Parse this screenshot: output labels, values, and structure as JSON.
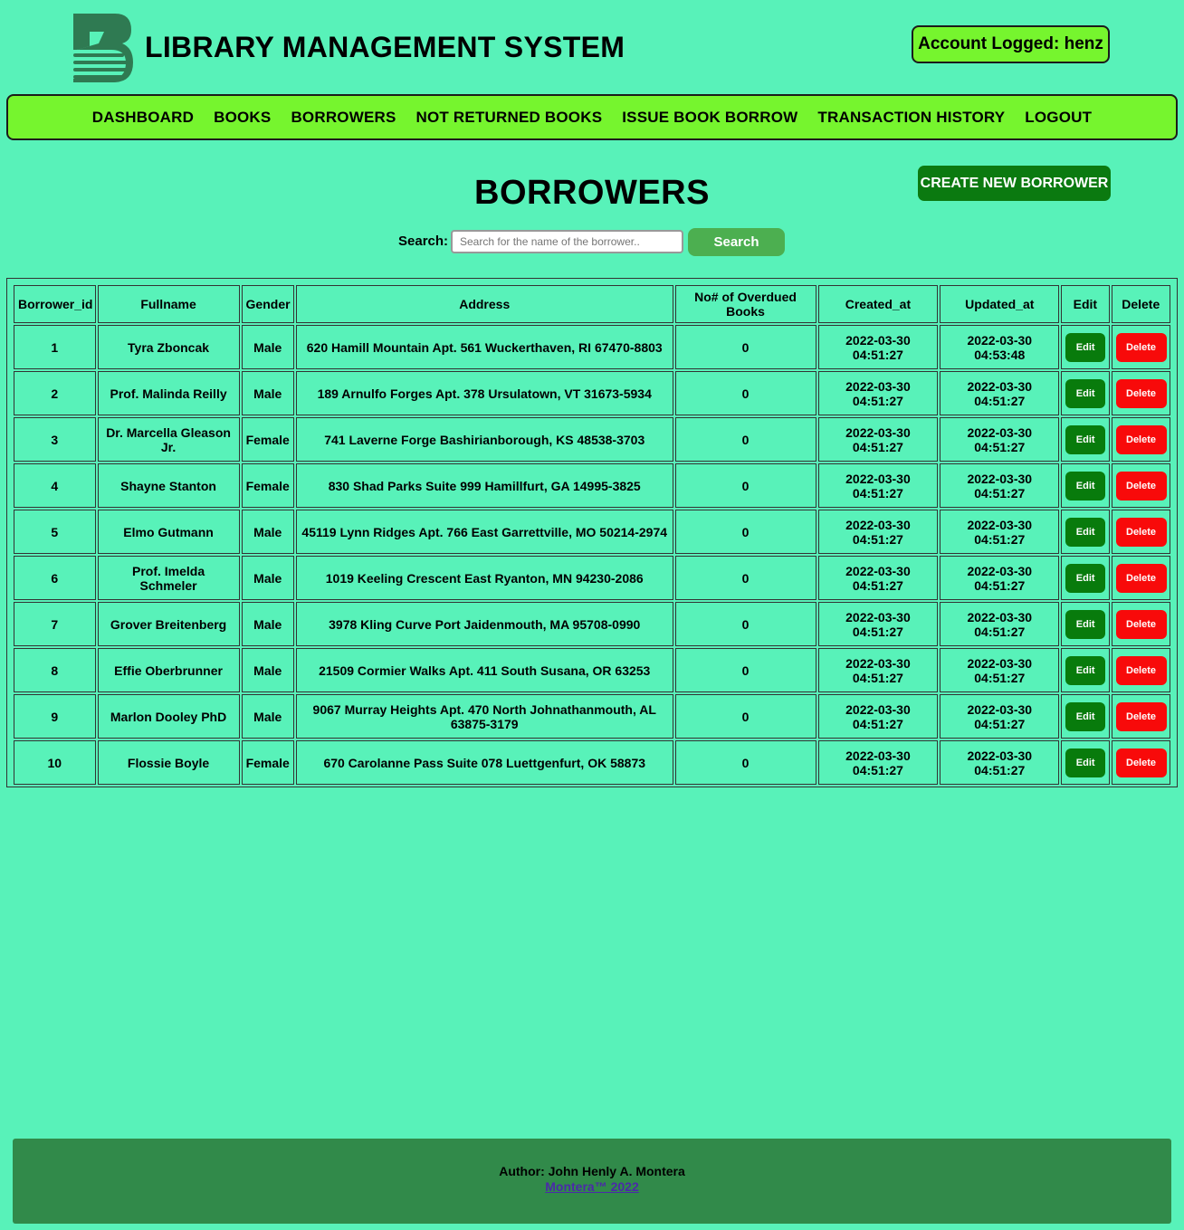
{
  "header": {
    "app_title": "LIBRARY MANAGEMENT SYSTEM",
    "account_label": "Account Logged: henz"
  },
  "nav": {
    "items": [
      "DASHBOARD",
      "BOOKS",
      "BORROWERS",
      "NOT RETURNED BOOKS",
      "ISSUE BOOK BORROW",
      "TRANSACTION HISTORY",
      "LOGOUT"
    ]
  },
  "main": {
    "title": "BORROWERS",
    "create_button": "CREATE NEW BORROWER",
    "search": {
      "label": "Search:",
      "placeholder": "Search for the name of the borrower..",
      "button": "Search"
    }
  },
  "table": {
    "columns": [
      "Borrower_id",
      "Fullname",
      "Gender",
      "Address",
      "No# of Overdued Books",
      "Created_at",
      "Updated_at",
      "Edit",
      "Delete"
    ],
    "edit_label": "Edit",
    "delete_label": "Delete",
    "rows": [
      {
        "id": "1",
        "fullname": "Tyra Zboncak",
        "gender": "Male",
        "address": "620 Hamill Mountain Apt. 561 Wuckerthaven, RI 67470-8803",
        "overdue": "0",
        "created_date": "2022-03-30",
        "created_time": "04:51:27",
        "updated_date": "2022-03-30",
        "updated_time": "04:53:48"
      },
      {
        "id": "2",
        "fullname": "Prof. Malinda Reilly",
        "gender": "Male",
        "address": "189 Arnulfo Forges Apt. 378 Ursulatown, VT 31673-5934",
        "overdue": "0",
        "created_date": "2022-03-30",
        "created_time": "04:51:27",
        "updated_date": "2022-03-30",
        "updated_time": "04:51:27"
      },
      {
        "id": "3",
        "fullname": "Dr. Marcella Gleason Jr.",
        "gender": "Female",
        "address": "741 Laverne Forge Bashirianborough, KS 48538-3703",
        "overdue": "0",
        "created_date": "2022-03-30",
        "created_time": "04:51:27",
        "updated_date": "2022-03-30",
        "updated_time": "04:51:27"
      },
      {
        "id": "4",
        "fullname": "Shayne Stanton",
        "gender": "Female",
        "address": "830 Shad Parks Suite 999 Hamillfurt, GA 14995-3825",
        "overdue": "0",
        "created_date": "2022-03-30",
        "created_time": "04:51:27",
        "updated_date": "2022-03-30",
        "updated_time": "04:51:27"
      },
      {
        "id": "5",
        "fullname": "Elmo Gutmann",
        "gender": "Male",
        "address": "45119 Lynn Ridges Apt. 766 East Garrettville, MO 50214-2974",
        "overdue": "0",
        "created_date": "2022-03-30",
        "created_time": "04:51:27",
        "updated_date": "2022-03-30",
        "updated_time": "04:51:27"
      },
      {
        "id": "6",
        "fullname": "Prof. Imelda Schmeler",
        "gender": "Male",
        "address": "1019 Keeling Crescent East Ryanton, MN 94230-2086",
        "overdue": "0",
        "created_date": "2022-03-30",
        "created_time": "04:51:27",
        "updated_date": "2022-03-30",
        "updated_time": "04:51:27"
      },
      {
        "id": "7",
        "fullname": "Grover Breitenberg",
        "gender": "Male",
        "address": "3978 Kling Curve Port Jaidenmouth, MA 95708-0990",
        "overdue": "0",
        "created_date": "2022-03-30",
        "created_time": "04:51:27",
        "updated_date": "2022-03-30",
        "updated_time": "04:51:27"
      },
      {
        "id": "8",
        "fullname": "Effie Oberbrunner",
        "gender": "Male",
        "address": "21509 Cormier Walks Apt. 411 South Susana, OR 63253",
        "overdue": "0",
        "created_date": "2022-03-30",
        "created_time": "04:51:27",
        "updated_date": "2022-03-30",
        "updated_time": "04:51:27"
      },
      {
        "id": "9",
        "fullname": "Marlon Dooley PhD",
        "gender": "Male",
        "address": "9067 Murray Heights Apt. 470 North Johnathanmouth, AL 63875-3179",
        "overdue": "0",
        "created_date": "2022-03-30",
        "created_time": "04:51:27",
        "updated_date": "2022-03-30",
        "updated_time": "04:51:27"
      },
      {
        "id": "10",
        "fullname": "Flossie Boyle",
        "gender": "Female",
        "address": "670 Carolanne Pass Suite 078 Luettgenfurt, OK 58873",
        "overdue": "0",
        "created_date": "2022-03-30",
        "created_time": "04:51:27",
        "updated_date": "2022-03-30",
        "updated_time": "04:51:27"
      }
    ]
  },
  "footer": {
    "author": "Author: John Henly A. Montera",
    "link": "Montera™ 2022"
  },
  "icons": {
    "logo": "book-stack-logo-icon"
  },
  "colors": {
    "background": "#58f2b9",
    "nav_background": "#76f52e",
    "create_button": "#0b7a10",
    "edit_button": "#087b0c",
    "delete_button": "#f80a0a",
    "search_button": "#4caf50",
    "footer_background": "#318a4a",
    "footer_link": "#4b2aa8"
  }
}
